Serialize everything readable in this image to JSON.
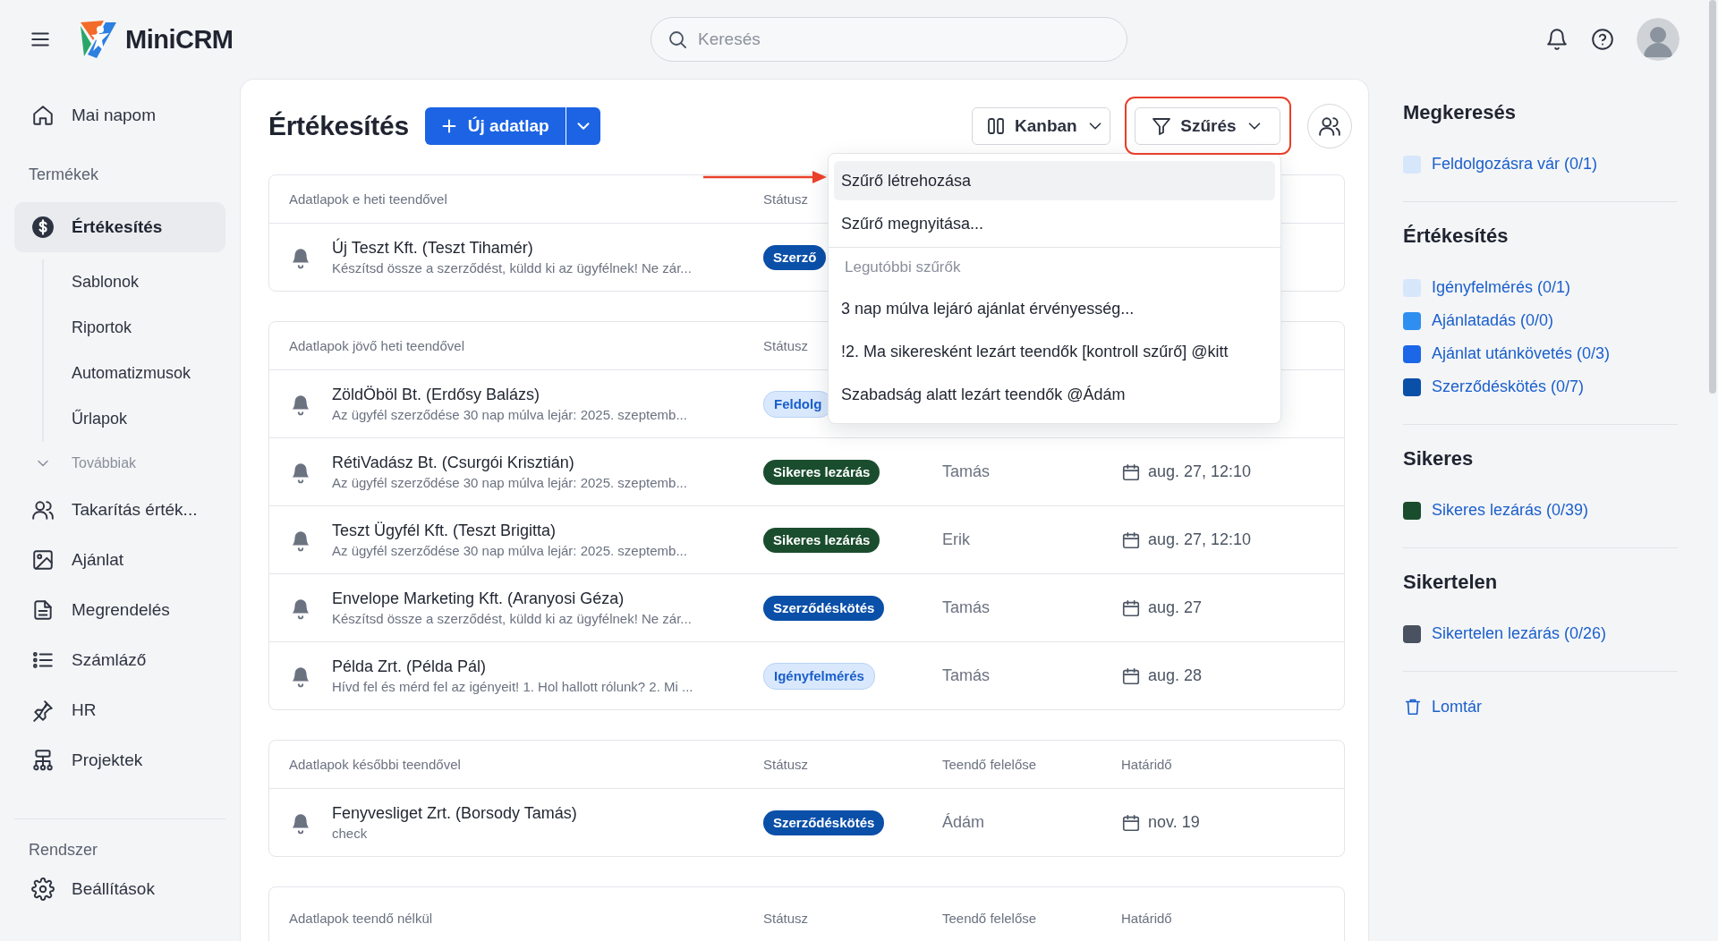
{
  "topbar": {
    "logo_text": "MiniCRM",
    "search": {
      "placeholder": "Keresés"
    }
  },
  "sidebar": {
    "items": [
      {
        "kind": "link",
        "label": "Mai napom",
        "selected": false
      },
      {
        "kind": "section",
        "label": "Termékek"
      },
      {
        "kind": "link",
        "label": "Értékesítés",
        "selected": true
      },
      {
        "kind": "sub",
        "label": "Sablonok"
      },
      {
        "kind": "sub",
        "label": "Riportok"
      },
      {
        "kind": "sub",
        "label": "Automatizmusok"
      },
      {
        "kind": "sub",
        "label": "Űrlapok"
      },
      {
        "kind": "more",
        "label": "Továbbiak"
      },
      {
        "kind": "link",
        "label": "Takarítás érték...",
        "selected": false
      },
      {
        "kind": "link",
        "label": "Ajánlat",
        "selected": false
      },
      {
        "kind": "link",
        "label": "Megrendelés",
        "selected": false
      },
      {
        "kind": "link",
        "label": "Számláző",
        "selected": false
      },
      {
        "kind": "link",
        "label": "HR",
        "selected": false
      },
      {
        "kind": "link",
        "label": "Projektek",
        "selected": false
      }
    ],
    "footer": [
      {
        "kind": "section",
        "label": "Rendszer"
      },
      {
        "kind": "link",
        "label": "Beállítások",
        "selected": false
      }
    ]
  },
  "page": {
    "title": "Értékesítés",
    "new_button": "Új adatlap",
    "view_button": "Kanban",
    "filter_button": "Szűrés"
  },
  "filter_menu": {
    "items": [
      {
        "kind": "action",
        "label": "Szűrő létrehozása",
        "selected": true
      },
      {
        "kind": "action",
        "label": "Szűrő megnyitása...",
        "selected": false
      },
      {
        "kind": "heading",
        "label": "Legutóbbi szűrők"
      },
      {
        "kind": "saved",
        "label": "3 nap múlva lejáró ajánlat érvényesség...",
        "selected": false
      },
      {
        "kind": "saved",
        "label": "!2. Ma sikeresként lezárt teendők [kontroll szűrő] @kitt",
        "selected": false
      },
      {
        "kind": "saved",
        "label": "Szabadság alatt lezárt teendők @Ádám",
        "selected": false
      }
    ]
  },
  "groups": [
    {
      "columns": [
        "Adatlapok e heti teendővel",
        "Státusz"
      ],
      "rows": [
        {
          "name": "Új Teszt Kft. (Teszt Tihamér)",
          "note": "Készítsd össze a szerződést, küldd ki az ügyfélnek! Ne zár...",
          "status": {
            "label": "Szerző",
            "kind": "contract"
          }
        }
      ]
    },
    {
      "columns": [
        "Adatlapok jövő heti teendővel",
        "Státusz"
      ],
      "rows": [
        {
          "name": "ZöldÖböl Bt. (Erdősy Balázs)",
          "note": "Az ügyfél szerződése 30 nap múlva lejár: 2025. szeptemb...",
          "status": {
            "label": "Feldolg",
            "kind": "light"
          }
        },
        {
          "name": "RétiVadász Bt. (Csurgói Krisztián)",
          "note": "Az ügyfél szerződése 30 nap múlva lejár: 2025. szeptemb...",
          "status": {
            "label": "Sikeres lezárás",
            "kind": "won"
          },
          "owner": "Tamás",
          "due": "aug. 27, 12:10"
        },
        {
          "name": "Teszt Ügyfél Kft. (Teszt Brigitta)",
          "note": "Az ügyfél szerződése 30 nap múlva lejár: 2025. szeptemb...",
          "status": {
            "label": "Sikeres lezárás",
            "kind": "won"
          },
          "owner": "Erik",
          "due": "aug. 27, 12:10"
        },
        {
          "name": "Envelope Marketing Kft. (Aranyosi Géza)",
          "note": "Készítsd össze a szerződést, küldd ki az ügyfélnek! Ne zár...",
          "status": {
            "label": "Szerződéskötés",
            "kind": "contract"
          },
          "owner": "Tamás",
          "due": "aug. 27"
        },
        {
          "name": "Példa Zrt. (Példa Pál)",
          "note": "Hívd fel és mérd fel az igényeit! 1. Hol hallott rólunk? 2. Mi ...",
          "status": {
            "label": "Igényfelmérés",
            "kind": "light"
          },
          "owner": "Tamás",
          "due": "aug. 28"
        }
      ]
    },
    {
      "columns": [
        "Adatlapok későbbi teendővel",
        "Státusz",
        "Teendő felelőse",
        "Határidő"
      ],
      "rows": [
        {
          "name": "Fenyvesliget Zrt. (Borsody Tamás)",
          "note": "check",
          "status": {
            "label": "Szerződéskötés",
            "kind": "contract"
          },
          "owner": "Ádám",
          "due": "nov. 19"
        }
      ]
    },
    {
      "columns": [
        "Adatlapok teendő nélkül",
        "Státusz",
        "Teendő felelőse",
        "Határidő"
      ]
    }
  ],
  "stages": {
    "sections": [
      {
        "title": "Megkeresés",
        "items": [
          {
            "label": "Feldolgozásra vár (0/1)",
            "color": "#d6e6fb"
          }
        ]
      },
      {
        "title": "Értékesítés",
        "items": [
          {
            "label": "Igényfelmérés (0/1)",
            "color": "#d6e6fb"
          },
          {
            "label": "Ajánlatadás (0/0)",
            "color": "#2f8ff0"
          },
          {
            "label": "Ajánlat utánkövetés (0/3)",
            "color": "#1c66e8"
          },
          {
            "label": "Szerződéskötés (0/7)",
            "color": "#0a4fa8"
          }
        ]
      },
      {
        "title": "Sikeres",
        "items": [
          {
            "label": "Sikeres lezárás (0/39)",
            "color": "#1a4d2e"
          }
        ]
      },
      {
        "title": "Sikertelen",
        "items": [
          {
            "label": "Sikertelen lezárás (0/26)",
            "color": "#4a5160"
          }
        ]
      }
    ],
    "trash": "Lomtár"
  }
}
